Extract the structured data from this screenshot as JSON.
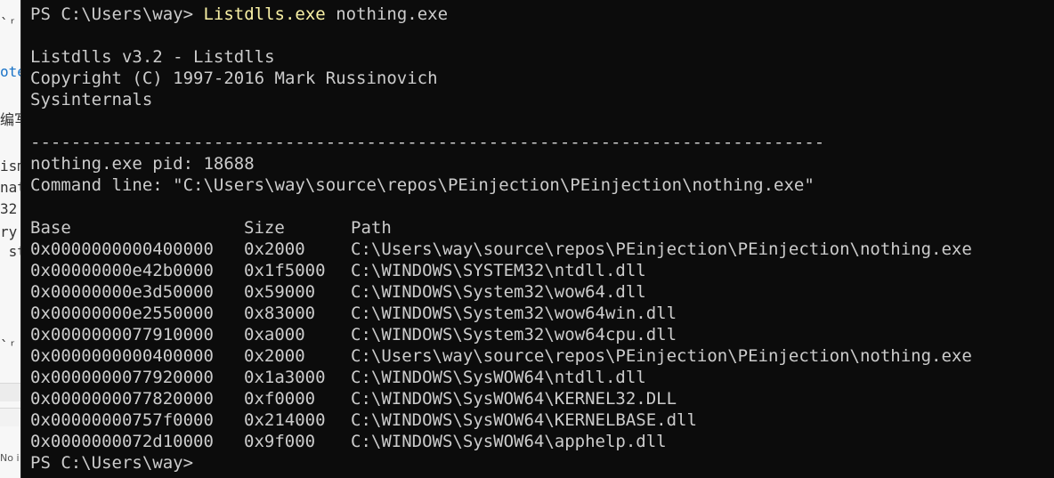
{
  "background_editor": {
    "fragments": [
      {
        "text": "`ʳ"
      },
      {
        "text": "ote"
      },
      {
        "text": "编写"
      },
      {
        "text": "ism"
      },
      {
        "text": "nat"
      },
      {
        "text": "32"
      },
      {
        "text": "ry"
      },
      {
        "text": " st"
      },
      {
        "text": "`ʳ"
      },
      {
        "text": "No i"
      }
    ]
  },
  "terminal": {
    "prompt": "PS C:\\Users\\way> ",
    "command_name": "Listdlls.exe",
    "command_args": " nothing.exe",
    "banner": [
      "Listdlls v3.2 - Listdlls",
      "Copyright (C) 1997-2016 Mark Russinovich",
      "Sysinternals"
    ],
    "separator": "------------------------------------------------------------------------------",
    "process_line": "nothing.exe pid: 18688",
    "command_line": "Command line: \"C:\\Users\\way\\source\\repos\\PEinjection\\PEinjection\\nothing.exe\"",
    "table": {
      "headers": {
        "base": "Base",
        "size": "Size",
        "path": "Path"
      },
      "rows": [
        {
          "base": "0x0000000000400000",
          "size": "0x2000",
          "path": "C:\\Users\\way\\source\\repos\\PEinjection\\PEinjection\\nothing.exe"
        },
        {
          "base": "0x00000000e42b0000",
          "size": "0x1f5000",
          "path": "C:\\WINDOWS\\SYSTEM32\\ntdll.dll"
        },
        {
          "base": "0x00000000e3d50000",
          "size": "0x59000",
          "path": "C:\\WINDOWS\\System32\\wow64.dll"
        },
        {
          "base": "0x00000000e2550000",
          "size": "0x83000",
          "path": "C:\\WINDOWS\\System32\\wow64win.dll"
        },
        {
          "base": "0x0000000077910000",
          "size": "0xa000",
          "path": "C:\\WINDOWS\\System32\\wow64cpu.dll"
        },
        {
          "base": "0x0000000000400000",
          "size": "0x2000",
          "path": "C:\\Users\\way\\source\\repos\\PEinjection\\PEinjection\\nothing.exe"
        },
        {
          "base": "0x0000000077920000",
          "size": "0x1a3000",
          "path": "C:\\WINDOWS\\SysWOW64\\ntdll.dll"
        },
        {
          "base": "0x0000000077820000",
          "size": "0xf0000",
          "path": "C:\\WINDOWS\\SysWOW64\\KERNEL32.DLL"
        },
        {
          "base": "0x00000000757f0000",
          "size": "0x214000",
          "path": "C:\\WINDOWS\\SysWOW64\\KERNELBASE.dll"
        },
        {
          "base": "0x0000000072d10000",
          "size": "0x9f000",
          "path": "C:\\WINDOWS\\SysWOW64\\apphelp.dll"
        }
      ]
    },
    "final_prompt": "PS C:\\Users\\way>"
  },
  "colors": {
    "terminal_background": "#0c0c0c",
    "terminal_text": "#cccccc",
    "command_highlight": "#f9f1a5"
  }
}
